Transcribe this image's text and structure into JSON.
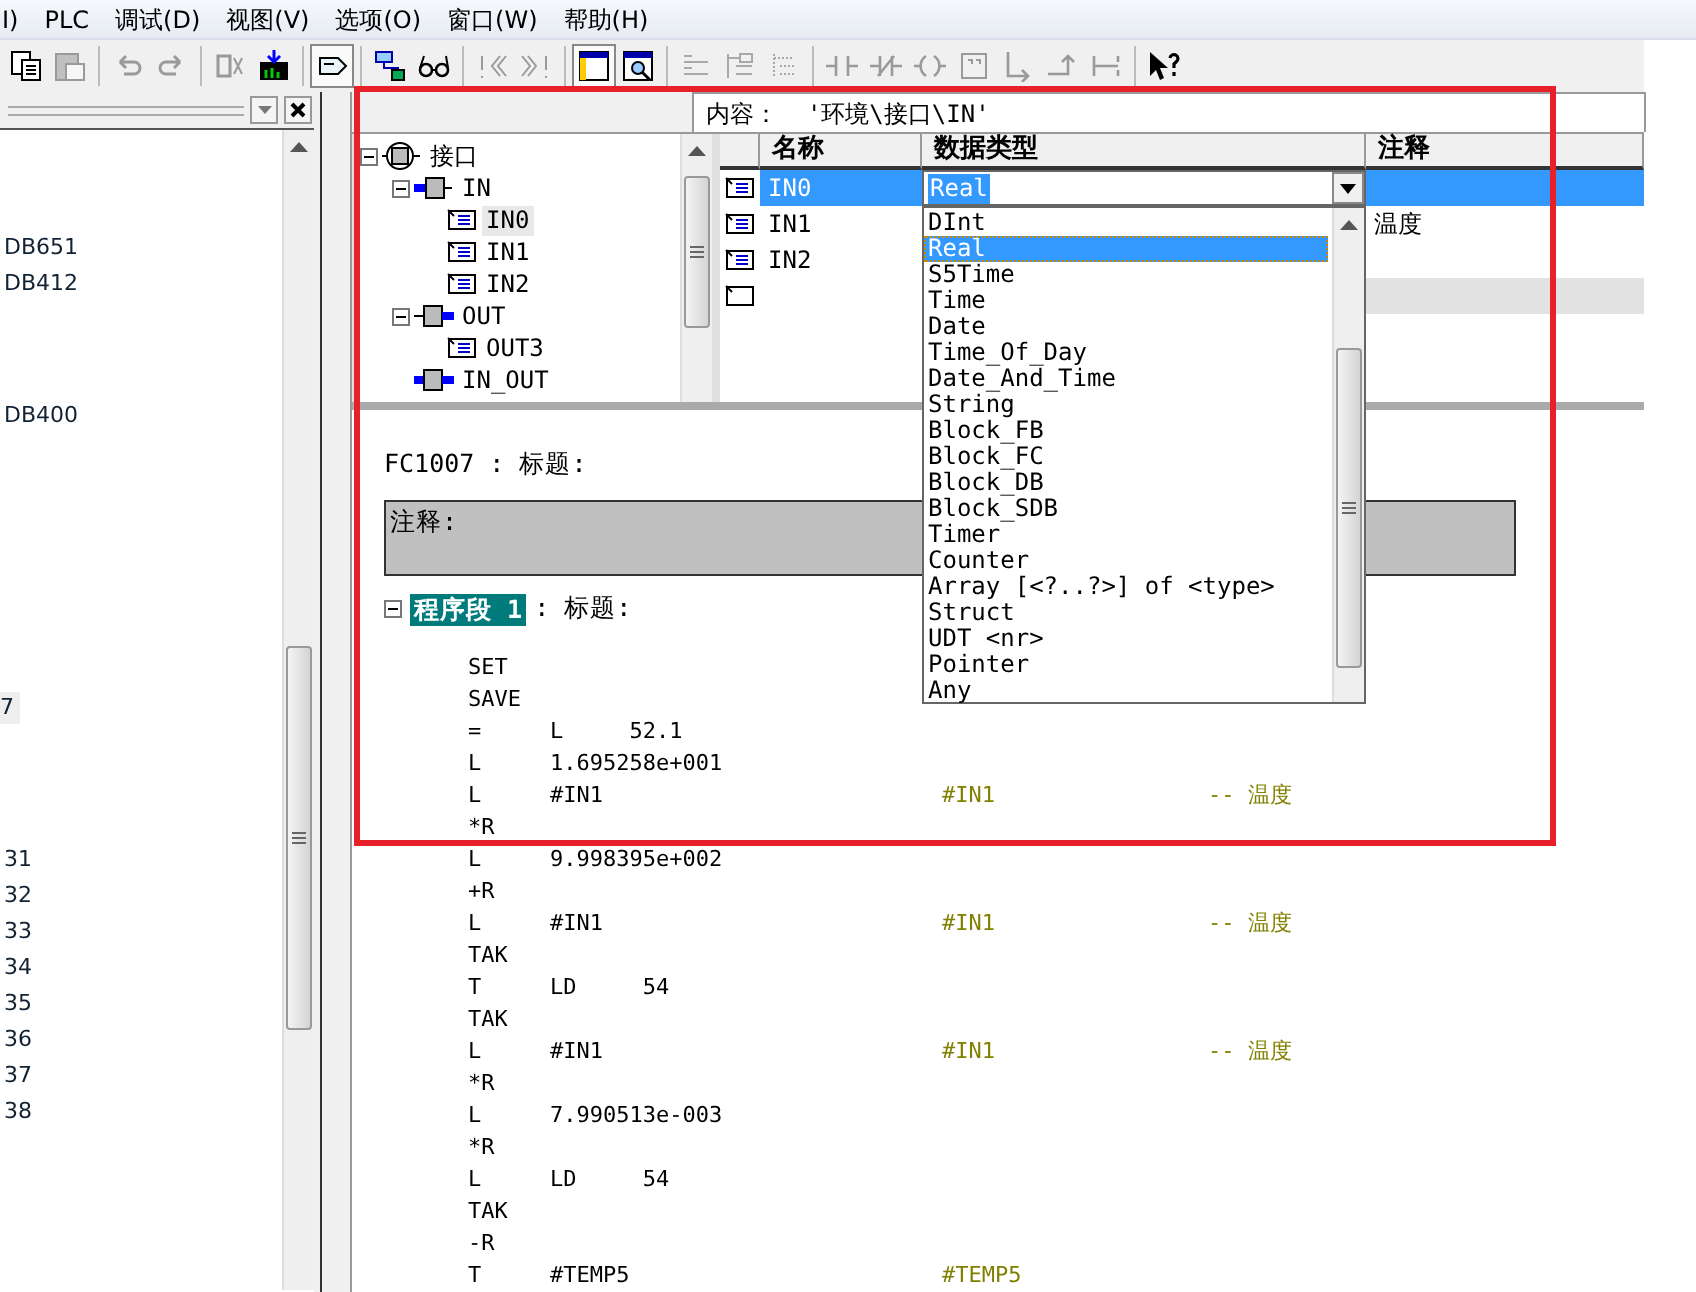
{
  "menu": [
    "I)",
    "PLC",
    "调试(D)",
    "视图(V)",
    "选项(O)",
    "窗口(W)",
    "帮助(H)"
  ],
  "toolbar": [
    {
      "kind": "copy",
      "disabled": false
    },
    {
      "kind": "paste",
      "disabled": true
    },
    {
      "kind": "separator"
    },
    {
      "kind": "undo",
      "disabled": true
    },
    {
      "kind": "redo",
      "disabled": true
    },
    {
      "kind": "separator"
    },
    {
      "kind": "compile",
      "disabled": true
    },
    {
      "kind": "download",
      "disabled": false
    },
    {
      "kind": "separator"
    },
    {
      "kind": "tag",
      "disabled": false,
      "pressed": true
    },
    {
      "kind": "separator"
    },
    {
      "kind": "network",
      "disabled": false
    },
    {
      "kind": "glasses",
      "disabled": false
    },
    {
      "kind": "separator"
    },
    {
      "kind": "first",
      "disabled": true
    },
    {
      "kind": "last",
      "disabled": true
    },
    {
      "kind": "separator"
    },
    {
      "kind": "window",
      "disabled": false,
      "pressed": true
    },
    {
      "kind": "zoomwindow",
      "disabled": false
    },
    {
      "kind": "separator"
    },
    {
      "kind": "list1",
      "disabled": true
    },
    {
      "kind": "list2",
      "disabled": true
    },
    {
      "kind": "list3",
      "disabled": true
    },
    {
      "kind": "separator"
    },
    {
      "kind": "contact",
      "disabled": true
    },
    {
      "kind": "ncontact",
      "disabled": true
    },
    {
      "kind": "coil",
      "disabled": true
    },
    {
      "kind": "box",
      "disabled": true
    },
    {
      "kind": "branchopen",
      "disabled": true
    },
    {
      "kind": "branchclose",
      "disabled": true
    },
    {
      "kind": "connector",
      "disabled": true
    },
    {
      "kind": "separator"
    },
    {
      "kind": "help",
      "disabled": false
    }
  ],
  "left_panel": {
    "groups": [
      [
        {
          "label": "DB651",
          "selected": false
        },
        {
          "label": "DB412",
          "selected": false
        }
      ],
      [
        {
          "label": "DB400",
          "selected": false
        }
      ],
      [
        {
          "label": "7",
          "selected": true
        }
      ],
      [
        {
          "label": "31",
          "selected": false
        },
        {
          "label": "32",
          "selected": false
        },
        {
          "label": "33",
          "selected": false
        },
        {
          "label": "34",
          "selected": false
        },
        {
          "label": "35",
          "selected": false
        },
        {
          "label": "36",
          "selected": false
        },
        {
          "label": "37",
          "selected": false
        },
        {
          "label": "38",
          "selected": false
        }
      ]
    ]
  },
  "contents_path": "内容：  '环境\\接口\\IN'",
  "tree": [
    {
      "label": "接口",
      "kind": "interface",
      "selected": false,
      "expanded": true,
      "children": [
        {
          "label": "IN",
          "kind": "in",
          "selected": false,
          "expanded": true,
          "children": [
            {
              "label": "IN0",
              "kind": "param",
              "selected": true
            },
            {
              "label": "IN1",
              "kind": "param",
              "selected": false
            },
            {
              "label": "IN2",
              "kind": "param",
              "selected": false
            }
          ]
        },
        {
          "label": "OUT",
          "kind": "out",
          "selected": false,
          "expanded": true,
          "children": [
            {
              "label": "OUT3",
              "kind": "param",
              "selected": false
            }
          ]
        },
        {
          "label": "IN_OUT",
          "kind": "inout",
          "selected": false
        }
      ]
    }
  ],
  "table": {
    "columns": [
      "名称",
      "数据类型",
      "注释"
    ],
    "rows": [
      {
        "kind": "param",
        "name": "IN0",
        "selected": true
      },
      {
        "kind": "param",
        "name": "IN1",
        "comment": "温度",
        "selected": false
      },
      {
        "kind": "param",
        "name": "IN2",
        "selected": false
      },
      {
        "kind": "new",
        "selected": false
      }
    ],
    "type_editor": {
      "value": "Real",
      "options": [
        {
          "label": "DInt",
          "selected": false
        },
        {
          "label": "Real",
          "selected": true
        },
        {
          "label": "S5Time",
          "selected": false
        },
        {
          "label": "Time",
          "selected": false
        },
        {
          "label": "Date",
          "selected": false
        },
        {
          "label": "Time_Of_Day",
          "selected": false
        },
        {
          "label": "Date_And_Time",
          "selected": false
        },
        {
          "label": "String",
          "selected": false
        },
        {
          "label": "Block_FB",
          "selected": false
        },
        {
          "label": "Block_FC",
          "selected": false
        },
        {
          "label": "Block_DB",
          "selected": false
        },
        {
          "label": "Block_SDB",
          "selected": false
        },
        {
          "label": "Timer",
          "selected": false
        },
        {
          "label": "Counter",
          "selected": false
        },
        {
          "label": "Array [<?..?>] of <type>",
          "selected": false
        },
        {
          "label": "Struct",
          "selected": false
        },
        {
          "label": "UDT <nr>",
          "selected": false
        },
        {
          "label": "Pointer",
          "selected": false
        },
        {
          "label": "Any",
          "selected": false
        }
      ]
    }
  },
  "code": {
    "block_title": "FC1007 : 标题:",
    "comment_label": "注释:",
    "network": {
      "label": "程序段 1",
      "title": ": 标题:",
      "expanded": true
    },
    "lines": [
      {
        "op": "SET"
      },
      {
        "op": "SAVE"
      },
      {
        "op": "=",
        "operand": "L     52.1"
      },
      {
        "op": "L",
        "operand": "1.695258e+001"
      },
      {
        "op": "L",
        "operand": "#IN1",
        "symbol": "#IN1",
        "comment": "-- 温度"
      },
      {
        "op": "*R"
      },
      {
        "op": "L",
        "operand": "9.998395e+002"
      },
      {
        "op": "+R"
      },
      {
        "op": "L",
        "operand": "#IN1",
        "symbol": "#IN1",
        "comment": "-- 温度"
      },
      {
        "op": "TAK"
      },
      {
        "op": "T",
        "operand": "LD     54"
      },
      {
        "op": "TAK"
      },
      {
        "op": "L",
        "operand": "#IN1",
        "symbol": "#IN1",
        "comment": "-- 温度"
      },
      {
        "op": "*R"
      },
      {
        "op": "L",
        "operand": "7.990513e-003"
      },
      {
        "op": "*R"
      },
      {
        "op": "L",
        "operand": "LD     54"
      },
      {
        "op": "TAK"
      },
      {
        "op": "-R"
      },
      {
        "op": "T",
        "operand": "#TEMP5",
        "symbol": "#TEMP5"
      }
    ]
  }
}
